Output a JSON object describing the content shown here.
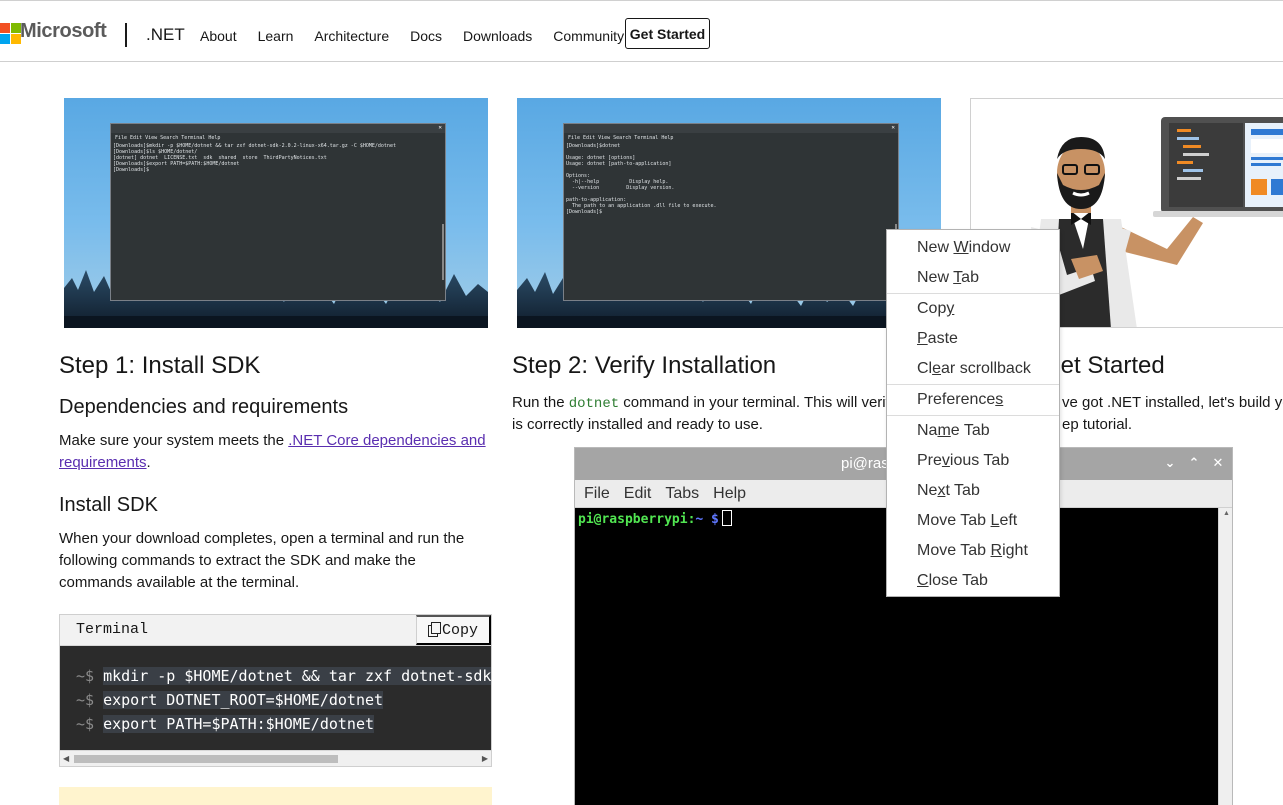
{
  "header": {
    "logo_text": "Microsoft",
    "brand": ".NET",
    "nav": [
      "About",
      "Learn",
      "Architecture",
      "Docs",
      "Downloads",
      "Community"
    ],
    "cta": "Get Started",
    "logo_colors": [
      "#f25022",
      "#7fba00",
      "#00a4ef",
      "#ffb900"
    ]
  },
  "thumb1": {
    "menu": "File  Edit  View  Search  Terminal  Help",
    "lines": [
      "[Downloads]$mkdir -p $HOME/dotnet && tar zxf dotnet-sdk-2.0.2-linux-x64.tar.gz -C $HOME/dotnet",
      "[Downloads]$ls $HOME/dotnet/",
      "[dotnet] dotnet  LICENSE.txt  sdk  shared  store  ThirdPartyNotices.txt",
      "[Downloads]$export PATH=$PATH:$HOME/dotnet",
      "[Downloads]$"
    ]
  },
  "thumb2": {
    "menu": "File  Edit  View  Search  Terminal  Help",
    "lines": [
      "[Downloads]$dotnet",
      "",
      "Usage: dotnet [options]",
      "Usage: dotnet [path-to-application]",
      "",
      "Options:",
      "  -h|--help          Display help.",
      "  --version         Display version.",
      "",
      "path-to-application:",
      "  The path to an application .dll file to execute.",
      "[Downloads]$"
    ]
  },
  "step1": {
    "title": "Step 1: Install SDK",
    "deps_heading": "Dependencies and requirements",
    "deps_text": "Make sure your system meets the ",
    "deps_link": ".NET Core dependencies and requirements",
    "deps_end": ".",
    "install_heading": "Install SDK",
    "install_text": "When your download completes, open a terminal and run the following commands to extract the SDK and make the commands available at the terminal."
  },
  "codeblock": {
    "title": "Terminal",
    "copy_label": "Copy",
    "prompt": "~$",
    "lines": [
      "mkdir -p $HOME/dotnet && tar zxf dotnet-sdk-linux-arm.tar.gz -C $HOME/dotnet",
      "export DOTNET_ROOT=$HOME/dotnet",
      "export PATH=$PATH:$HOME/dotnet"
    ]
  },
  "step2": {
    "title": "Step 2: Verify Installation",
    "text_pre": "Run the ",
    "code": "dotnet",
    "text_post": " command in your terminal. This will verif",
    "text_line2": "is correctly installed and ready to use."
  },
  "step3": {
    "title_fragment": "Get Started",
    "line1": "ve got .NET installed, let's build yo",
    "line2": "ep tutorial."
  },
  "lxterminal": {
    "title": "pi@ras",
    "menu": [
      "File",
      "Edit",
      "Tabs",
      "Help"
    ],
    "prompt_user": "pi@raspberrypi",
    "prompt_sep": ":",
    "prompt_path": "~ $",
    "controls": [
      "chevron-down",
      "chevron-up",
      "close"
    ]
  },
  "context_menu": {
    "items": [
      {
        "pre": "New ",
        "key": "W",
        "post": "indow"
      },
      {
        "pre": "New ",
        "key": "T",
        "post": "ab"
      },
      {
        "sep": true
      },
      {
        "pre": "Cop",
        "key": "y",
        "post": ""
      },
      {
        "pre": "",
        "key": "P",
        "post": "aste"
      },
      {
        "pre": "Cl",
        "key": "e",
        "post": "ar scrollback"
      },
      {
        "sep": true
      },
      {
        "pre": "Preference",
        "key": "s",
        "post": ""
      },
      {
        "sep": true
      },
      {
        "pre": "Na",
        "key": "m",
        "post": "e Tab"
      },
      {
        "pre": "Pre",
        "key": "v",
        "post": "ious Tab"
      },
      {
        "pre": "Ne",
        "key": "x",
        "post": "t Tab"
      },
      {
        "pre": "Move Tab ",
        "key": "L",
        "post": "eft"
      },
      {
        "pre": "Move Tab ",
        "key": "R",
        "post": "ight"
      },
      {
        "pre": "",
        "key": "C",
        "post": "lose Tab"
      }
    ]
  }
}
